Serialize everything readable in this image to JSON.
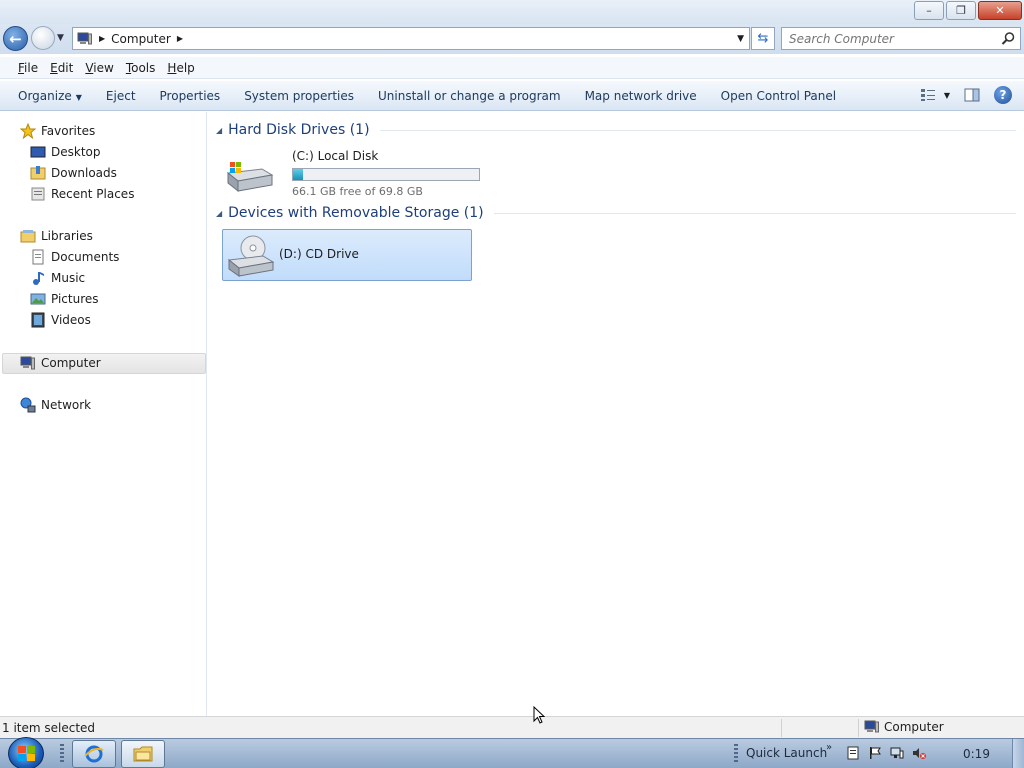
{
  "window": {
    "buttons": {
      "minimize": "–",
      "maximize": "❐",
      "close": "✕"
    }
  },
  "address_bar": {
    "path_icon": "computer-icon",
    "path": "Computer",
    "search_placeholder": "Search Computer"
  },
  "menu": [
    {
      "label": "File",
      "accesskey": "F",
      "rest": "ile"
    },
    {
      "label": "Edit",
      "accesskey": "E",
      "rest": "dit"
    },
    {
      "label": "View",
      "accesskey": "V",
      "rest": "iew"
    },
    {
      "label": "Tools",
      "accesskey": "T",
      "rest": "ools"
    },
    {
      "label": "Help",
      "accesskey": "H",
      "rest": "elp"
    }
  ],
  "commands": {
    "organize": "Organize",
    "eject": "Eject",
    "properties": "Properties",
    "system_properties": "System properties",
    "uninstall": "Uninstall or change a program",
    "map_drive": "Map network drive",
    "control_panel": "Open Control Panel",
    "help": "?"
  },
  "nav": {
    "favorites": "Favorites",
    "desktop": "Desktop",
    "downloads": "Downloads",
    "recent_places": "Recent Places",
    "libraries": "Libraries",
    "documents": "Documents",
    "music": "Music",
    "pictures": "Pictures",
    "videos": "Videos",
    "computer": "Computer",
    "network": "Network",
    "selected": "Computer"
  },
  "groups": {
    "hard_disk": "Hard Disk Drives (1)",
    "removable": "Devices with Removable Storage (1)"
  },
  "drives": {
    "c": {
      "name": "(C:) Local Disk",
      "free_text": "66.1 GB free of 69.8 GB",
      "used_fraction": 0.053
    },
    "d": {
      "name": "(D:) CD Drive"
    }
  },
  "status": {
    "selection": "1 item selected",
    "location": "Computer"
  },
  "taskbar": {
    "quick_launch": "Quick Launch",
    "chevron": "»",
    "clock": "0:19"
  },
  "colors": {
    "accent": "#1e3f7a",
    "selection": "#c1dcfb",
    "disk_bar": "#1b8fb8"
  }
}
